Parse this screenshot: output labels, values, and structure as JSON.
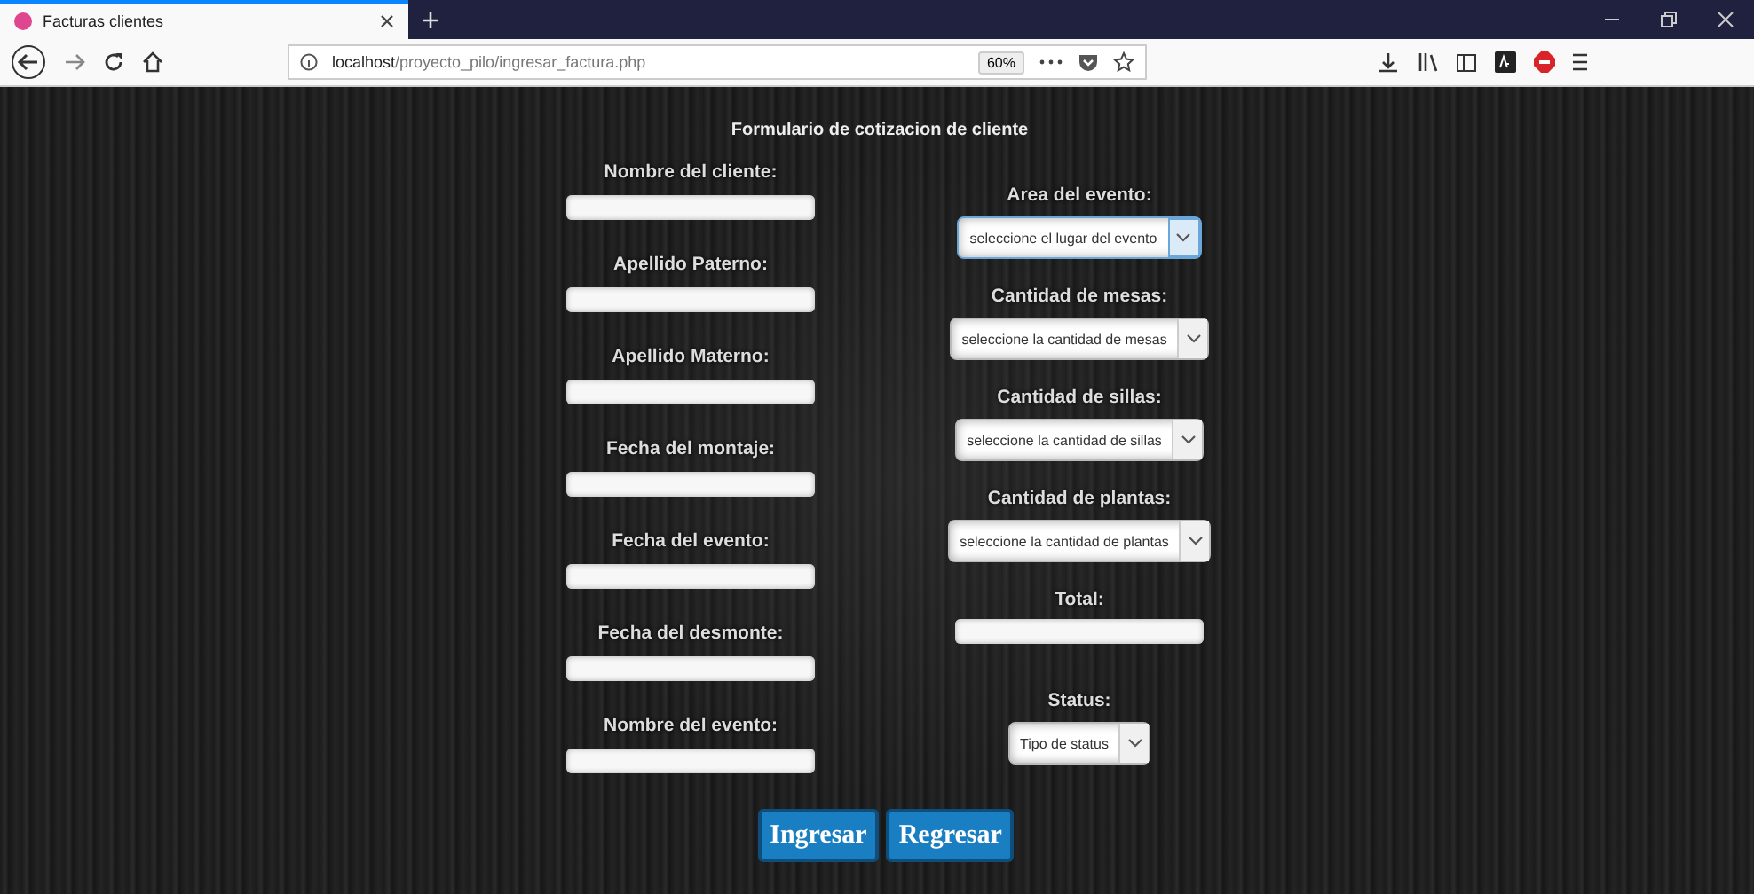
{
  "browser": {
    "tab": {
      "title": "Facturas clientes",
      "selected": true
    },
    "url": {
      "host": "localhost",
      "path": "/proyecto_pilo/ingresar_factura.php"
    },
    "zoom": "60%"
  },
  "form": {
    "title": "Formulario de cotizacion de cliente",
    "left_fields": [
      {
        "label": "Nombre del cliente:"
      },
      {
        "label": "Apellido Paterno:"
      },
      {
        "label": "Apellido Materno:"
      },
      {
        "label": "Fecha del montaje:"
      },
      {
        "label": "Fecha del evento:"
      },
      {
        "label": "Fecha del desmonte:"
      },
      {
        "label": "Nombre del evento:"
      }
    ],
    "right_fields": [
      {
        "kind": "select",
        "label": "Area del evento:",
        "value": "seleccione el lugar del evento",
        "focused": true
      },
      {
        "kind": "select",
        "label": "Cantidad de mesas:",
        "value": "seleccione la cantidad de mesas",
        "focused": false
      },
      {
        "kind": "select",
        "label": "Cantidad de sillas:",
        "value": "seleccione la cantidad de sillas",
        "focused": false
      },
      {
        "kind": "select",
        "label": "Cantidad de plantas:",
        "value": "seleccione la cantidad de plantas",
        "focused": false
      },
      {
        "kind": "text",
        "label": "Total:"
      },
      {
        "kind": "select",
        "label": "Status:",
        "value": "Tipo de status",
        "focused": false
      }
    ],
    "buttons": [
      "Ingresar",
      "Regresar"
    ]
  }
}
